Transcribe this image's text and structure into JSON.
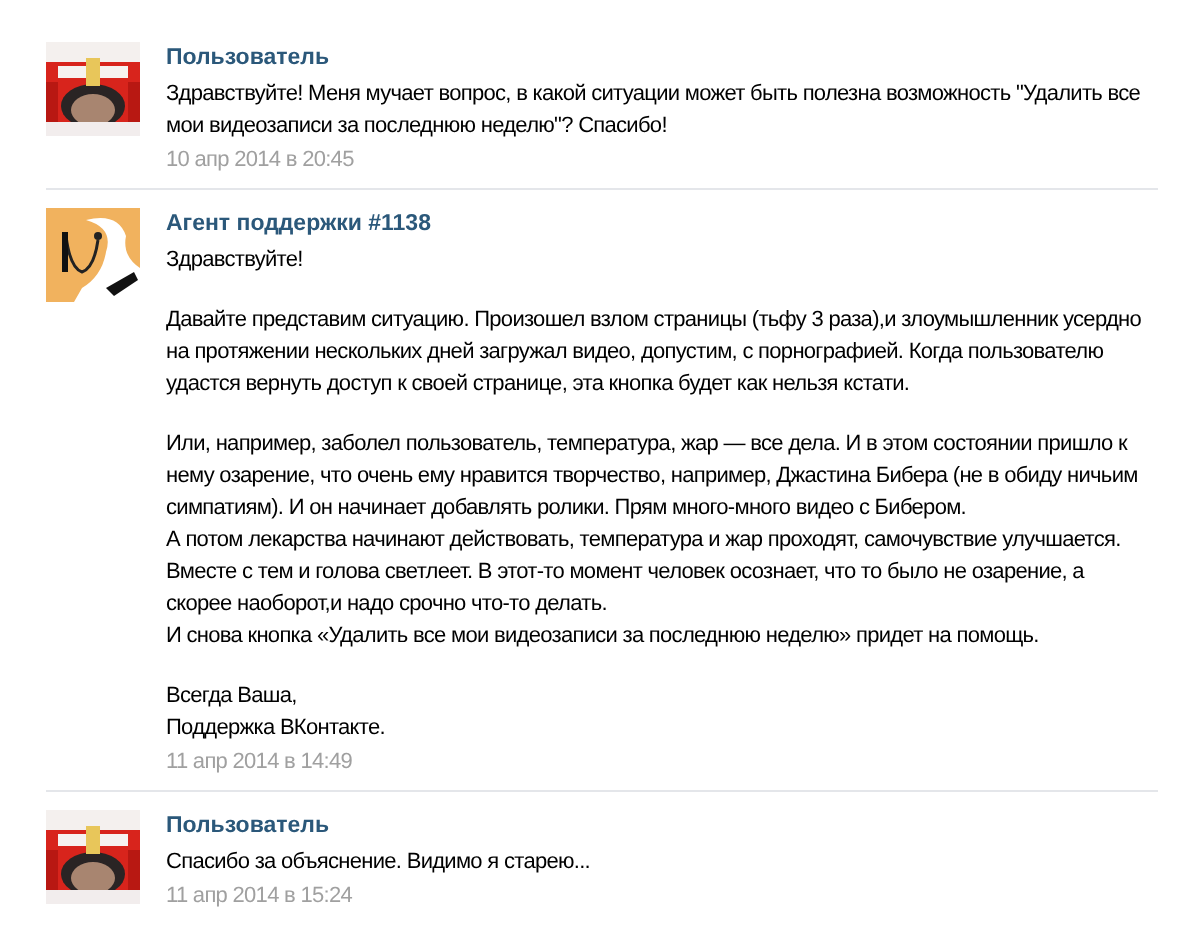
{
  "messages": [
    {
      "kind": "user",
      "author": "Пользователь",
      "paragraphs": [
        "Здравствуйте! Меня мучает вопрос, в какой ситуации может быть полезна возможность \"Удалить все\nмои видеозаписи за последнюю неделю\"? Спасибо!"
      ],
      "date": "10 апр 2014 в 20:45"
    },
    {
      "kind": "agent",
      "author": "Агент поддержки #1138",
      "paragraphs": [
        "Здравствуйте!",
        "Давайте представим ситуацию. Произошел взлом страницы (тьфу 3 раза),и злоумышленник усердно\nна протяжении нескольких дней загружал видео, допустим, с порнографией. Когда пользователю\nудастся вернуть доступ к своей странице, эта кнопка будет как нельзя кстати.",
        "Или, например, заболел пользователь, температура, жар — все дела. И в этом состоянии пришло к\nнему озарение, что очень ему нравится творчество, например, Джастина Бибера (не в обиду ничьим\nсимпатиям). И он начинает добавлять ролики. Прям много-много видео с Бибером.\nА потом лекарства начинают действовать, температура и жар проходят, самочувствие улучшается.\nВместе с тем и голова светлеет. В этот-то момент человек осознает, что то было не озарение, а\nскорее наоборот,и надо срочно что-то делать.\nИ снова кнопка «Удалить все мои видеозаписи за последнюю неделю» придет на помощь.",
        "Всегда Ваша,\nПоддержка ВКонтакте."
      ],
      "date": "11 апр 2014 в 14:49"
    },
    {
      "kind": "user",
      "author": "Пользователь",
      "paragraphs": [
        "Спасибо за объяснение. Видимо я старею..."
      ],
      "date": "11 апр 2014 в 15:24"
    }
  ]
}
